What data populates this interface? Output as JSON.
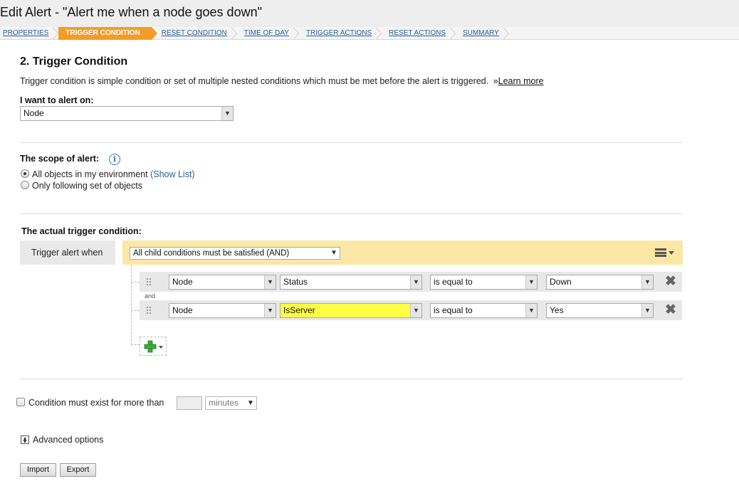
{
  "window": {
    "title": "Edit Alert - \"Alert me when a node goes down\""
  },
  "wizard": {
    "steps": [
      {
        "label": "PROPERTIES"
      },
      {
        "label": "TRIGGER CONDITION"
      },
      {
        "label": "RESET CONDITION"
      },
      {
        "label": "TIME OF DAY"
      },
      {
        "label": "TRIGGER ACTIONS"
      },
      {
        "label": "RESET ACTIONS"
      },
      {
        "label": "SUMMARY"
      }
    ],
    "active_step": "TRIGGER CONDITION",
    "active_color": "#f39c28"
  },
  "section": {
    "heading": "2. Trigger Condition",
    "description": "Trigger condition is simple condition or set of multiple nested conditions which must be met before the alert is triggered.",
    "learn_more_prefix": "»",
    "learn_more": "Learn more"
  },
  "alert_on": {
    "label": "I want to alert on:",
    "value": "Node"
  },
  "scope": {
    "label": "The scope of alert:",
    "info_icon": "info-icon",
    "options": [
      {
        "label": "All objects in my environment",
        "selected": true
      },
      {
        "label": "Only following set of objects",
        "selected": false
      }
    ],
    "show_list": "(Show List)"
  },
  "trigger": {
    "label": "The actual trigger condition:",
    "when_label": "Trigger alert when",
    "group_operator": "All child conditions must be satisfied (AND)",
    "connector": "and",
    "conditions": [
      {
        "object": "Node",
        "field": "Status",
        "operator": "is equal to",
        "value": "Down",
        "highlighted": false
      },
      {
        "object": "Node",
        "field": "IsServer",
        "operator": "is equal to",
        "value": "Yes",
        "highlighted": true
      }
    ],
    "highlight_color": "#ffff44",
    "group_bg_color": "#fbe8a6"
  },
  "duration": {
    "label": "Condition must exist for more than",
    "amount": "",
    "unit": "minutes",
    "checked": false
  },
  "advanced": {
    "label": "Advanced options"
  },
  "buttons": {
    "import": "Import",
    "export": "Export"
  }
}
